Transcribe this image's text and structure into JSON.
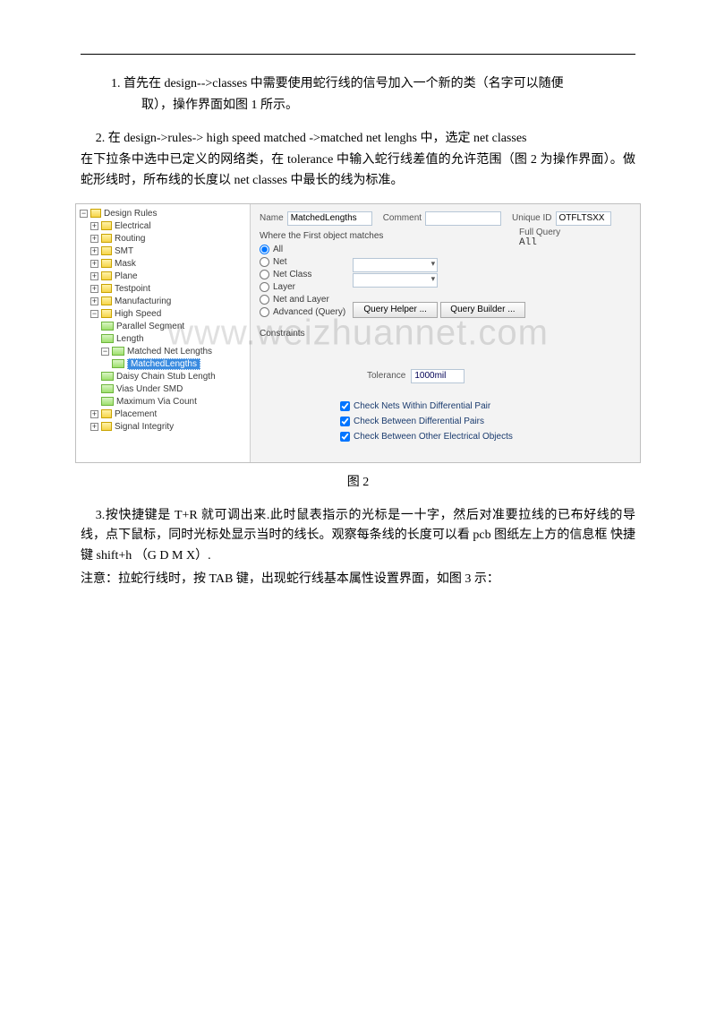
{
  "paragraphs": {
    "p1_a": "1.  首先在 design-->classes 中需要使用蛇行线的信号加入一个新的类（名字可以随便",
    "p1_b": "取），操作界面如图 1 所示。",
    "p2_a": "2.   在 design->rules-> high speed matched ->matched net   lenghs  中，选定 net classes",
    "p2_b": "在下拉条中选中已定义的网络类，在 tolerance 中输入蛇行线差值的允许范围（图 2 为操作界面）。做蛇形线时，所布线的长度以 net classes 中最长的线为标准。",
    "fig2": "图 2",
    "p3": "3.按快捷键是 T+R 就可调出来.此时鼠表指示的光标是一十字，然后对准要拉线的已布好线的导线，点下鼠标，同时光标处显示当时的线长。观察每条线的长度可以看 pcb 图纸左上方的信息框  快捷键 shift+h  （G   D   M   X）.",
    "p3_note": "注意：拉蛇行线时，按 TAB 键，出现蛇行线基本属性设置界面，如图 3 示："
  },
  "watermark": "www.weizhuannet.com",
  "ui": {
    "tree": {
      "root": "Design Rules",
      "electrical": "Electrical",
      "routing": "Routing",
      "smt": "SMT",
      "mask": "Mask",
      "plane": "Plane",
      "testpoint": "Testpoint",
      "manufacturing": "Manufacturing",
      "highspeed": "High Speed",
      "parallel": "Parallel Segment",
      "length": "Length",
      "matched": "Matched Net Lengths",
      "matched_rule": "MatchedLengths",
      "daisy": "Daisy Chain Stub Length",
      "vias_smd": "Vias Under SMD",
      "max_via": "Maximum Via Count",
      "placement": "Placement",
      "signal": "Signal Integrity"
    },
    "panel": {
      "name_lbl": "Name",
      "name_val": "MatchedLengths",
      "comment_lbl": "Comment",
      "comment_val": "",
      "uid_lbl": "Unique ID",
      "uid_val": "OTFLTSXX",
      "where_title": "Where the First object matches",
      "fullquery_lbl": "Full Query",
      "fullquery_val": "All",
      "r_all": "All",
      "r_net": "Net",
      "r_netclass": "Net Class",
      "r_layer": "Layer",
      "r_netlayer": "Net and Layer",
      "r_adv": "Advanced (Query)",
      "btn_helper": "Query Helper ...",
      "btn_builder": "Query Builder ...",
      "constraints": "Constraints",
      "tolerance_lbl": "Tolerance",
      "tolerance_val": "1000mil",
      "chk1": "Check Nets Within Differential Pair",
      "chk2": "Check Between Differential Pairs",
      "chk3": "Check Between Other Electrical Objects"
    }
  }
}
